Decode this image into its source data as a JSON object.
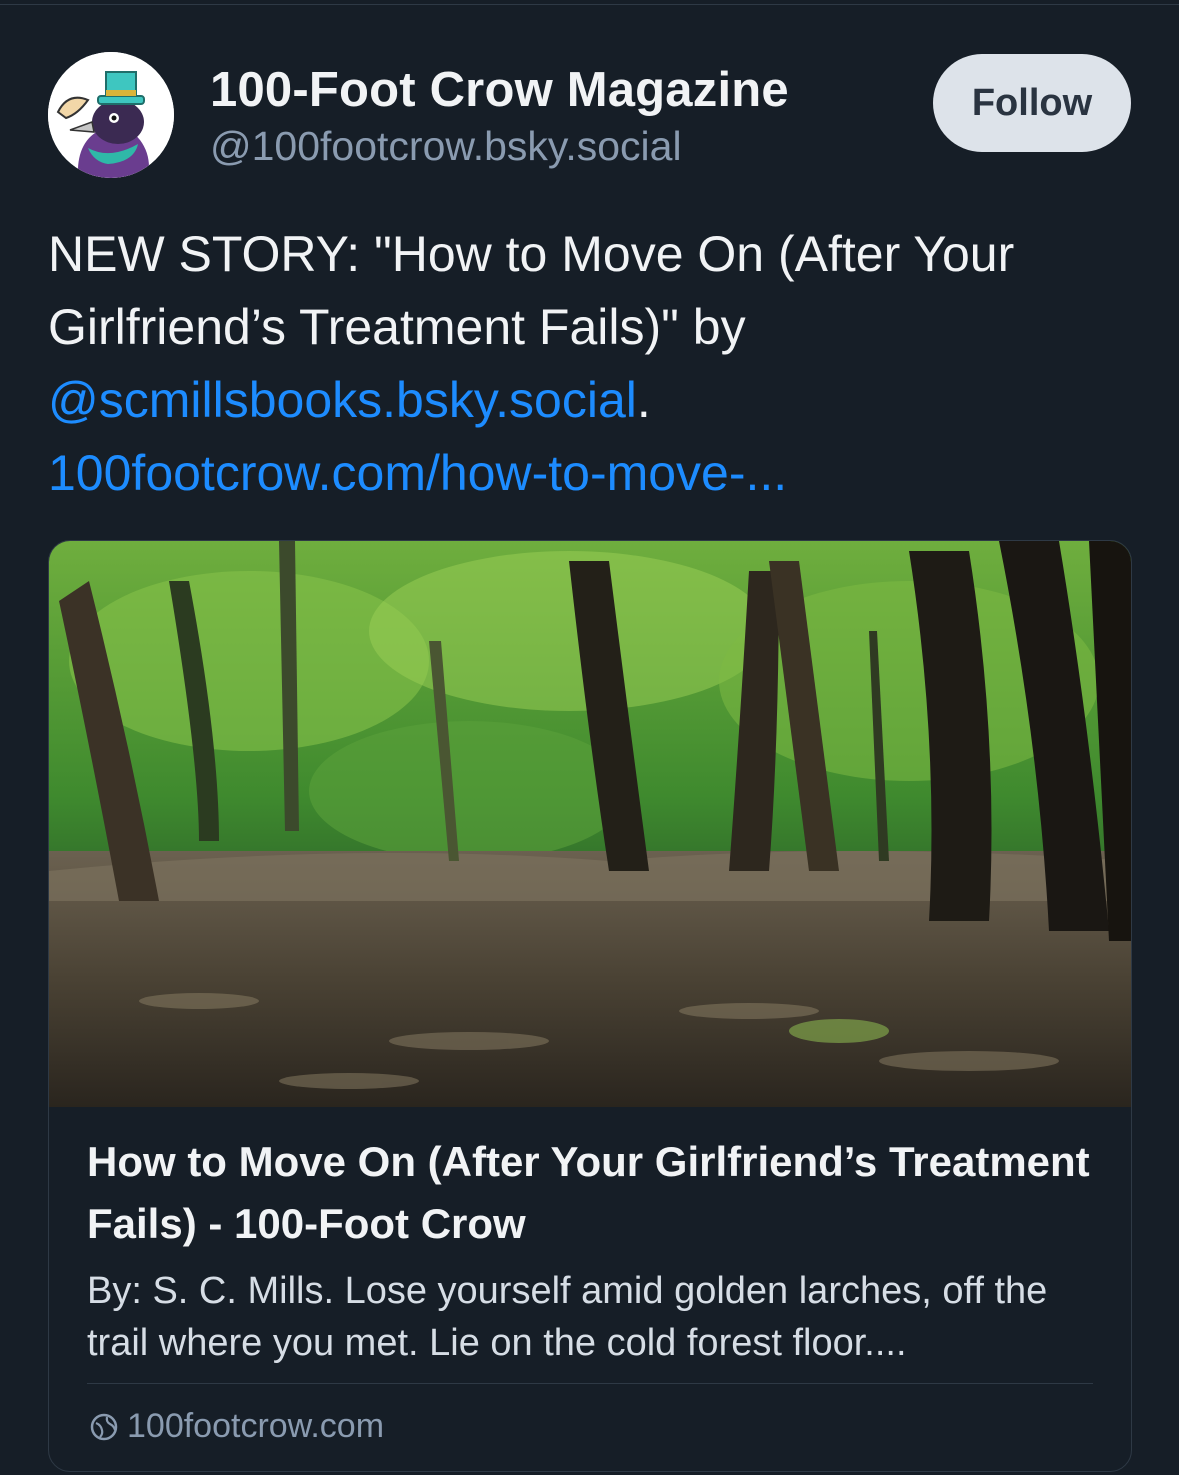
{
  "author": {
    "display_name": "100-Foot Crow Magazine",
    "handle": "@100footcrow.bsky.social",
    "avatar_icon": "crow-with-top-hat-avatar"
  },
  "follow_label": "Follow",
  "post": {
    "text_prefix": "NEW STORY: \"How to Move On (After Your Girlfriend’s Treatment Fails)\" by ",
    "mention": "@scmillsbooks.bsky.social",
    "period": ".",
    "link": "100footcrow.com/how-to-move-..."
  },
  "embed": {
    "image_icon": "forest-photo",
    "title": "How to Move On (After Your Girlfriend’s Treatment Fails) - 100-Foot Crow",
    "description": "By: S. C. Mills. Lose yourself amid golden larches, off the trail where you met. Lie on the cold forest floor....",
    "domain": "100footcrow.com",
    "domain_icon": "globe-icon"
  },
  "colors": {
    "background": "#161e27",
    "link": "#1d8cff",
    "follow_bg": "#dde3ea",
    "muted": "#8a9bb0"
  }
}
